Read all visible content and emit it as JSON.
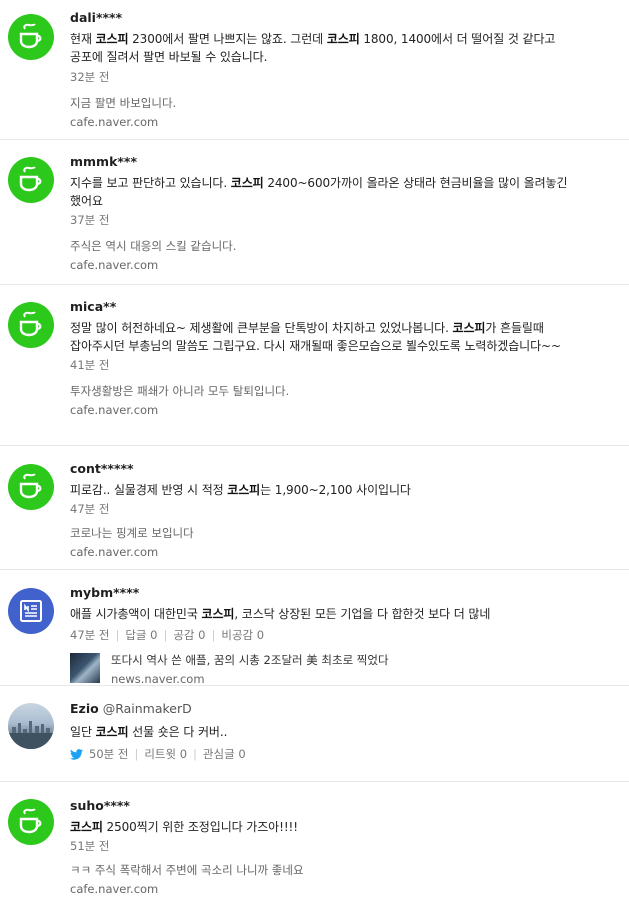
{
  "posts": [
    {
      "author": "dali****",
      "body": [
        {
          "t": "현재 "
        },
        {
          "t": "코스피",
          "b": true
        },
        {
          "t": " 2300에서 팔면 나쁘지는 않죠. 그런데 "
        },
        {
          "t": "코스피",
          "b": true
        },
        {
          "t": " 1800, 1400에서 더 떨어질 것 같다고 공포에 질려서 팔면 바보될 수 있습니다."
        }
      ],
      "time": "32분 전",
      "snippet": "지금 팔면 바보입니다.",
      "source": "cafe.naver.com"
    },
    {
      "author": "mmmk***",
      "body": [
        {
          "t": "지수를 보고 판단하고 있습니다. "
        },
        {
          "t": "코스피",
          "b": true
        },
        {
          "t": " 2400~600가까이 올라온 상태라 현금비율을 많이 올려놓긴 했어요"
        }
      ],
      "time": "37분 전",
      "snippet": "주식은 역시 대응의 스킬 같습니다.",
      "source": "cafe.naver.com"
    },
    {
      "author": "mica**",
      "body": [
        {
          "t": "정말 많이 허전하네요~ 제생활에 큰부분을 단톡방이 차지하고 있었나봅니다. "
        },
        {
          "t": "코스피",
          "b": true
        },
        {
          "t": "가 흔들릴때 잡아주시던 부총님의 말씀도 그립구요. 다시 재개될때 좋은모습으로 뵐수있도록 노력하겠습니다~~"
        }
      ],
      "time": "41분 전",
      "snippet": "투자생활방은 패쇄가 아니라 모두 탈퇴입니다.",
      "source": "cafe.naver.com"
    },
    {
      "author": "cont*****",
      "body": [
        {
          "t": "피로감.. 실물경제 반영 시 적정 "
        },
        {
          "t": "코스피",
          "b": true
        },
        {
          "t": "는 1,900~2,100 사이입니다"
        }
      ],
      "time": "47분 전",
      "snippet": "코로나는 핑계로 보입니다",
      "source": "cafe.naver.com"
    },
    {
      "author": "mybm****",
      "body": [
        {
          "t": "애플 시가총액이 대한민국 "
        },
        {
          "t": "코스피",
          "b": true
        },
        {
          "t": ", 코스닥 상장된 모든 기업을 다 합한것 보다 더 많네"
        }
      ],
      "time": "47분 전",
      "replies": "답글 0",
      "likes": "공감 0",
      "dislikes": "비공감 0",
      "news_title": "또다시 역사 쓴 애플, 꿈의 시총 2조달러 美 최초로 찍었다",
      "source": "news.naver.com"
    },
    {
      "author": "Ezio",
      "handle": "@RainmakerD",
      "body": [
        {
          "t": "일단 "
        },
        {
          "t": "코스피",
          "b": true
        },
        {
          "t": " 선물 숏은 다 커버.."
        }
      ],
      "time": "50분 전",
      "retweets": "리트윗 0",
      "favorites": "관심글 0"
    },
    {
      "author": "suho****",
      "body": [
        {
          "t": "코스피",
          "b": true
        },
        {
          "t": " 2500찍기 위한 조정입니다 가즈아!!!!"
        }
      ],
      "time": "51분 전",
      "snippet": "ㅋㅋ 주식 폭락해서 주변에 곡소리 나니까 좋네요",
      "source": "cafe.naver.com"
    }
  ],
  "colors": {
    "cafe": "#2dc81c",
    "news": "#4162cc",
    "twitter": "#1da1f2"
  },
  "icons": {
    "cafe": "coffee-cup-icon",
    "news": "news-icon",
    "twitter": "twitter-bird-icon"
  }
}
